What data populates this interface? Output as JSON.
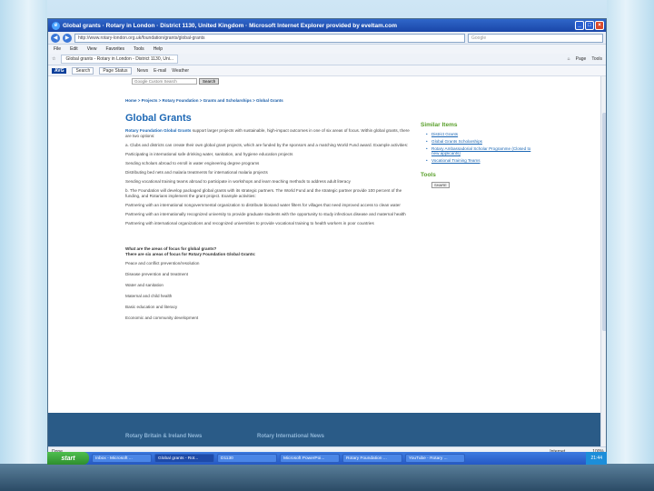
{
  "window": {
    "title": "Global grants · Rotary in London · District 1130, United Kingdom · Microsoft Internet Explorer provided by eveltam.com",
    "url": "http://www.rotary-london.org.uk/foundation/grants/global-grants",
    "search_placeholder": "Google"
  },
  "menu": [
    "File",
    "Edit",
    "View",
    "Favorites",
    "Tools",
    "Help"
  ],
  "tab": {
    "label": "Global grants - Rotary in London - District 1130, Uni..."
  },
  "favbar_right": [
    "Page",
    "Tools"
  ],
  "toolbar": {
    "avg": "AVG",
    "search": "Search",
    "page_status": "Page Status",
    "news": "News",
    "email": "E-mail",
    "weather": "Weather"
  },
  "site": {
    "search_placeholder": "Google Custom Search",
    "search_button": "Search",
    "breadcrumb": "Home > Projects > Rotary Foundation > Grants and Scholarships > Global Grants",
    "title": "Global Grants",
    "lead_bold": "Rotary Foundation Global Grants",
    "lead_rest": " support larger projects with sustainable, high-impact outcomes in one of six areas of focus. Within global grants, there are two options:",
    "option_a": "a. Clubs and districts can create their own global grant projects, which are funded by the sponsors and a matching World Fund award. Example activities:",
    "examples_a": [
      "Participating in international safe drinking water, sanitation, and hygiene education projects",
      "Sending scholars abroad to enroll in water engineering degree programs",
      "Distributing bed nets and malaria treatments for international malaria projects",
      "Sending vocational training teams abroad to participate in workshops and learn teaching methods to address adult literacy"
    ],
    "option_b": "b. The Foundation will develop packaged global grants with its strategic partners. The World Fund and the strategic partner provide 100 percent of the funding, and Rotarians implement the grant project. Example activities:",
    "examples_b": [
      "Partnering with an international nongovernmental organization to distribute biosand water filters for villages that need improved access to clean water",
      "Partnering with an internationally recognized university to provide graduate students with the opportunity to study infectious disease and maternal health",
      "Partnering with international organizations and recognized universities to provide vocational training to health workers in poor countries"
    ],
    "areas_heading": "What are the areas of focus for global grants?",
    "areas_sub": "There are six areas of focus for Rotary Foundation Global Grants:",
    "areas": [
      "Peace and conflict prevention/resolution",
      "Disease prevention and treatment",
      "Water and sanitation",
      "Maternal and child health",
      "Basic education and literacy",
      "Economic and community development"
    ],
    "similar_heading": "Similar Items",
    "similar_items": [
      "District Grants",
      "Global Grants Scholarships",
      "Rotary Ambassadorial Scholar Programme (Closed to new applicants)",
      "Vocational Training Teams"
    ],
    "tools_heading": "Tools",
    "share_label": "SHARE",
    "footer_left": "Rotary Britain & Ireland News",
    "footer_right": "Rotary International News"
  },
  "status": {
    "left": "Done",
    "zone": "Internet",
    "zoom": "100%"
  },
  "taskbar": {
    "start": "start",
    "tasks": [
      "Inbox - Microsoft ...",
      "Global grants - Rot...",
      "D1130",
      "Microsoft PowerPoi...",
      "Rotary Foundation ...",
      "YouTube - Rotary ..."
    ],
    "clock": "21:44"
  }
}
